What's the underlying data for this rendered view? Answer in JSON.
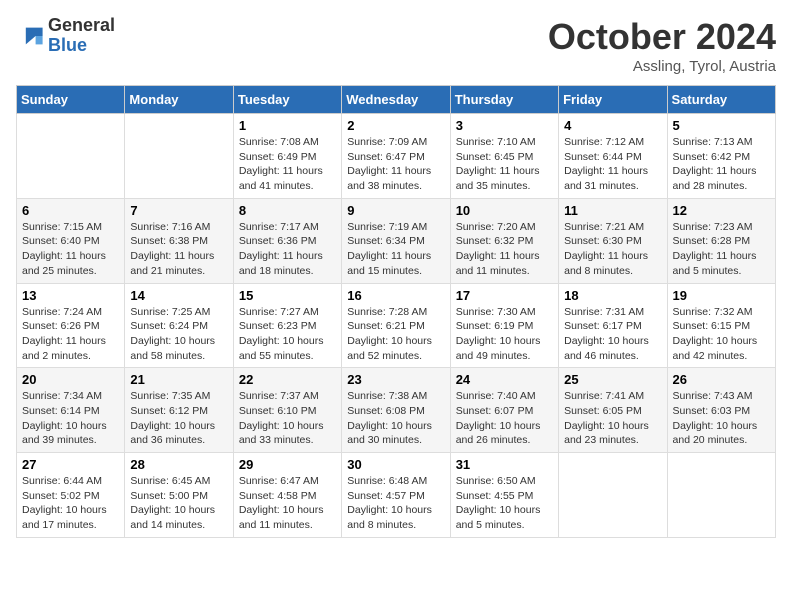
{
  "logo": {
    "general": "General",
    "blue": "Blue"
  },
  "header": {
    "month": "October 2024",
    "location": "Assling, Tyrol, Austria"
  },
  "weekdays": [
    "Sunday",
    "Monday",
    "Tuesday",
    "Wednesday",
    "Thursday",
    "Friday",
    "Saturday"
  ],
  "weeks": [
    [
      null,
      null,
      {
        "day": "1",
        "sunrise": "Sunrise: 7:08 AM",
        "sunset": "Sunset: 6:49 PM",
        "daylight": "Daylight: 11 hours and 41 minutes."
      },
      {
        "day": "2",
        "sunrise": "Sunrise: 7:09 AM",
        "sunset": "Sunset: 6:47 PM",
        "daylight": "Daylight: 11 hours and 38 minutes."
      },
      {
        "day": "3",
        "sunrise": "Sunrise: 7:10 AM",
        "sunset": "Sunset: 6:45 PM",
        "daylight": "Daylight: 11 hours and 35 minutes."
      },
      {
        "day": "4",
        "sunrise": "Sunrise: 7:12 AM",
        "sunset": "Sunset: 6:44 PM",
        "daylight": "Daylight: 11 hours and 31 minutes."
      },
      {
        "day": "5",
        "sunrise": "Sunrise: 7:13 AM",
        "sunset": "Sunset: 6:42 PM",
        "daylight": "Daylight: 11 hours and 28 minutes."
      }
    ],
    [
      {
        "day": "6",
        "sunrise": "Sunrise: 7:15 AM",
        "sunset": "Sunset: 6:40 PM",
        "daylight": "Daylight: 11 hours and 25 minutes."
      },
      {
        "day": "7",
        "sunrise": "Sunrise: 7:16 AM",
        "sunset": "Sunset: 6:38 PM",
        "daylight": "Daylight: 11 hours and 21 minutes."
      },
      {
        "day": "8",
        "sunrise": "Sunrise: 7:17 AM",
        "sunset": "Sunset: 6:36 PM",
        "daylight": "Daylight: 11 hours and 18 minutes."
      },
      {
        "day": "9",
        "sunrise": "Sunrise: 7:19 AM",
        "sunset": "Sunset: 6:34 PM",
        "daylight": "Daylight: 11 hours and 15 minutes."
      },
      {
        "day": "10",
        "sunrise": "Sunrise: 7:20 AM",
        "sunset": "Sunset: 6:32 PM",
        "daylight": "Daylight: 11 hours and 11 minutes."
      },
      {
        "day": "11",
        "sunrise": "Sunrise: 7:21 AM",
        "sunset": "Sunset: 6:30 PM",
        "daylight": "Daylight: 11 hours and 8 minutes."
      },
      {
        "day": "12",
        "sunrise": "Sunrise: 7:23 AM",
        "sunset": "Sunset: 6:28 PM",
        "daylight": "Daylight: 11 hours and 5 minutes."
      }
    ],
    [
      {
        "day": "13",
        "sunrise": "Sunrise: 7:24 AM",
        "sunset": "Sunset: 6:26 PM",
        "daylight": "Daylight: 11 hours and 2 minutes."
      },
      {
        "day": "14",
        "sunrise": "Sunrise: 7:25 AM",
        "sunset": "Sunset: 6:24 PM",
        "daylight": "Daylight: 10 hours and 58 minutes."
      },
      {
        "day": "15",
        "sunrise": "Sunrise: 7:27 AM",
        "sunset": "Sunset: 6:23 PM",
        "daylight": "Daylight: 10 hours and 55 minutes."
      },
      {
        "day": "16",
        "sunrise": "Sunrise: 7:28 AM",
        "sunset": "Sunset: 6:21 PM",
        "daylight": "Daylight: 10 hours and 52 minutes."
      },
      {
        "day": "17",
        "sunrise": "Sunrise: 7:30 AM",
        "sunset": "Sunset: 6:19 PM",
        "daylight": "Daylight: 10 hours and 49 minutes."
      },
      {
        "day": "18",
        "sunrise": "Sunrise: 7:31 AM",
        "sunset": "Sunset: 6:17 PM",
        "daylight": "Daylight: 10 hours and 46 minutes."
      },
      {
        "day": "19",
        "sunrise": "Sunrise: 7:32 AM",
        "sunset": "Sunset: 6:15 PM",
        "daylight": "Daylight: 10 hours and 42 minutes."
      }
    ],
    [
      {
        "day": "20",
        "sunrise": "Sunrise: 7:34 AM",
        "sunset": "Sunset: 6:14 PM",
        "daylight": "Daylight: 10 hours and 39 minutes."
      },
      {
        "day": "21",
        "sunrise": "Sunrise: 7:35 AM",
        "sunset": "Sunset: 6:12 PM",
        "daylight": "Daylight: 10 hours and 36 minutes."
      },
      {
        "day": "22",
        "sunrise": "Sunrise: 7:37 AM",
        "sunset": "Sunset: 6:10 PM",
        "daylight": "Daylight: 10 hours and 33 minutes."
      },
      {
        "day": "23",
        "sunrise": "Sunrise: 7:38 AM",
        "sunset": "Sunset: 6:08 PM",
        "daylight": "Daylight: 10 hours and 30 minutes."
      },
      {
        "day": "24",
        "sunrise": "Sunrise: 7:40 AM",
        "sunset": "Sunset: 6:07 PM",
        "daylight": "Daylight: 10 hours and 26 minutes."
      },
      {
        "day": "25",
        "sunrise": "Sunrise: 7:41 AM",
        "sunset": "Sunset: 6:05 PM",
        "daylight": "Daylight: 10 hours and 23 minutes."
      },
      {
        "day": "26",
        "sunrise": "Sunrise: 7:43 AM",
        "sunset": "Sunset: 6:03 PM",
        "daylight": "Daylight: 10 hours and 20 minutes."
      }
    ],
    [
      {
        "day": "27",
        "sunrise": "Sunrise: 6:44 AM",
        "sunset": "Sunset: 5:02 PM",
        "daylight": "Daylight: 10 hours and 17 minutes."
      },
      {
        "day": "28",
        "sunrise": "Sunrise: 6:45 AM",
        "sunset": "Sunset: 5:00 PM",
        "daylight": "Daylight: 10 hours and 14 minutes."
      },
      {
        "day": "29",
        "sunrise": "Sunrise: 6:47 AM",
        "sunset": "Sunset: 4:58 PM",
        "daylight": "Daylight: 10 hours and 11 minutes."
      },
      {
        "day": "30",
        "sunrise": "Sunrise: 6:48 AM",
        "sunset": "Sunset: 4:57 PM",
        "daylight": "Daylight: 10 hours and 8 minutes."
      },
      {
        "day": "31",
        "sunrise": "Sunrise: 6:50 AM",
        "sunset": "Sunset: 4:55 PM",
        "daylight": "Daylight: 10 hours and 5 minutes."
      },
      null,
      null
    ]
  ]
}
